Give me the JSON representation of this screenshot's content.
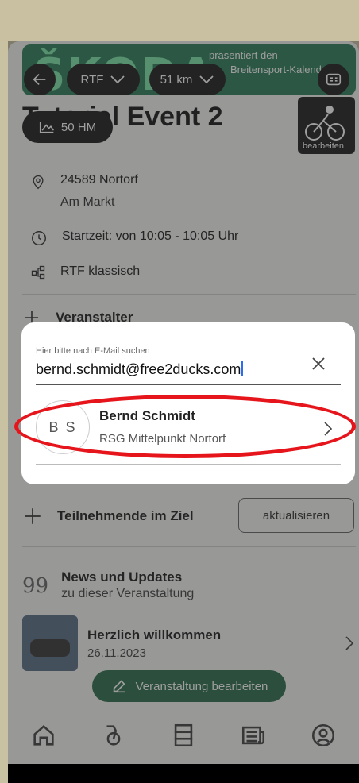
{
  "banner": {
    "logo": "ŠKODA",
    "line1": "präsentiert den",
    "line2": "Breitensport-Kalender"
  },
  "filters": {
    "type": "RTF",
    "distance": "51 km",
    "elevation": "50 HM"
  },
  "event": {
    "title": "Tutorial Event 2",
    "thumb_edit": "bearbeiten",
    "location_line1": "24589 Nortorf",
    "location_line2": "Am Markt",
    "start_time": "Startzeit: von 10:05 - 10:05 Uhr",
    "category": "RTF klassisch",
    "organizer_label": "Veranstalter"
  },
  "finish": {
    "label": "Teilnehmende im Ziel",
    "button": "aktualisieren"
  },
  "news": {
    "heading": "News und Updates",
    "sub": "zu dieser Veranstaltung",
    "item_title": "Herzlich willkommen",
    "item_date": "26.11.2023"
  },
  "fab": {
    "label": "Veranstaltung bearbeiten"
  },
  "tabbar": {
    "items": [
      "home-icon",
      "bike-icon",
      "calendar-list-icon",
      "news-icon",
      "profile-icon"
    ]
  },
  "dialog": {
    "search_label": "Hier bitte nach E-Mail suchen",
    "search_value": "bernd.schmidt@free2ducks.com",
    "result": {
      "initials": "B S",
      "name": "Bernd Schmidt",
      "club": "RSG Mittelpunkt Nortorf"
    }
  },
  "colors": {
    "accent_green": "#2f6e4f",
    "highlight_red": "#e6141b"
  }
}
